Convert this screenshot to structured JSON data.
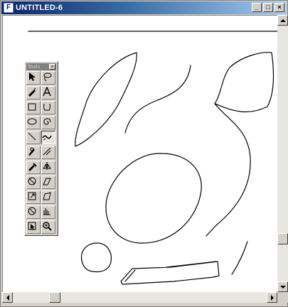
{
  "window": {
    "title": "UNTITLED-6",
    "app_icon": "fh-icon",
    "buttons": {
      "minimize": "_",
      "maximize": "□",
      "close": "×"
    }
  },
  "tools_panel": {
    "title": "Tools",
    "close_glyph": "×",
    "tools": [
      {
        "name": "pointer",
        "icon": "pointer-icon"
      },
      {
        "name": "lasso",
        "icon": "lasso-icon"
      },
      {
        "name": "pen",
        "icon": "pen-icon"
      },
      {
        "name": "text",
        "icon": "text-icon",
        "glyph": "A"
      },
      {
        "name": "rectangle",
        "icon": "rectangle-icon"
      },
      {
        "name": "bezigon",
        "icon": "bezigon-icon"
      },
      {
        "name": "ellipse",
        "icon": "ellipse-icon"
      },
      {
        "name": "spiral",
        "icon": "spiral-icon"
      },
      {
        "name": "line",
        "icon": "line-icon"
      },
      {
        "name": "freehand",
        "icon": "freehand-icon",
        "active": true
      },
      {
        "name": "knife",
        "icon": "knife-icon"
      },
      {
        "name": "trace",
        "icon": "trace-icon"
      },
      {
        "name": "eyedropper",
        "icon": "eyedropper-icon"
      },
      {
        "name": "reflect",
        "icon": "reflect-icon"
      },
      {
        "name": "rotate",
        "icon": "rotate-icon"
      },
      {
        "name": "skew",
        "icon": "skew-icon"
      },
      {
        "name": "scale",
        "icon": "scale-icon"
      },
      {
        "name": "distort",
        "icon": "distort-icon"
      },
      {
        "name": "fisheye",
        "icon": "fisheye-icon"
      },
      {
        "name": "graphic-hose",
        "icon": "graphic-hose-icon"
      },
      {
        "name": "subselect",
        "icon": "subselect-icon"
      },
      {
        "name": "zoom",
        "icon": "zoom-icon"
      }
    ]
  },
  "scrollbars": {
    "vertical": {
      "thumb_position": 0.85
    },
    "horizontal": {
      "thumb_position": 0.15
    }
  },
  "colors": {
    "title_start": "#0a246a",
    "title_end": "#a6caf0",
    "chrome": "#d4d0c8",
    "canvas": "#ffffff"
  }
}
